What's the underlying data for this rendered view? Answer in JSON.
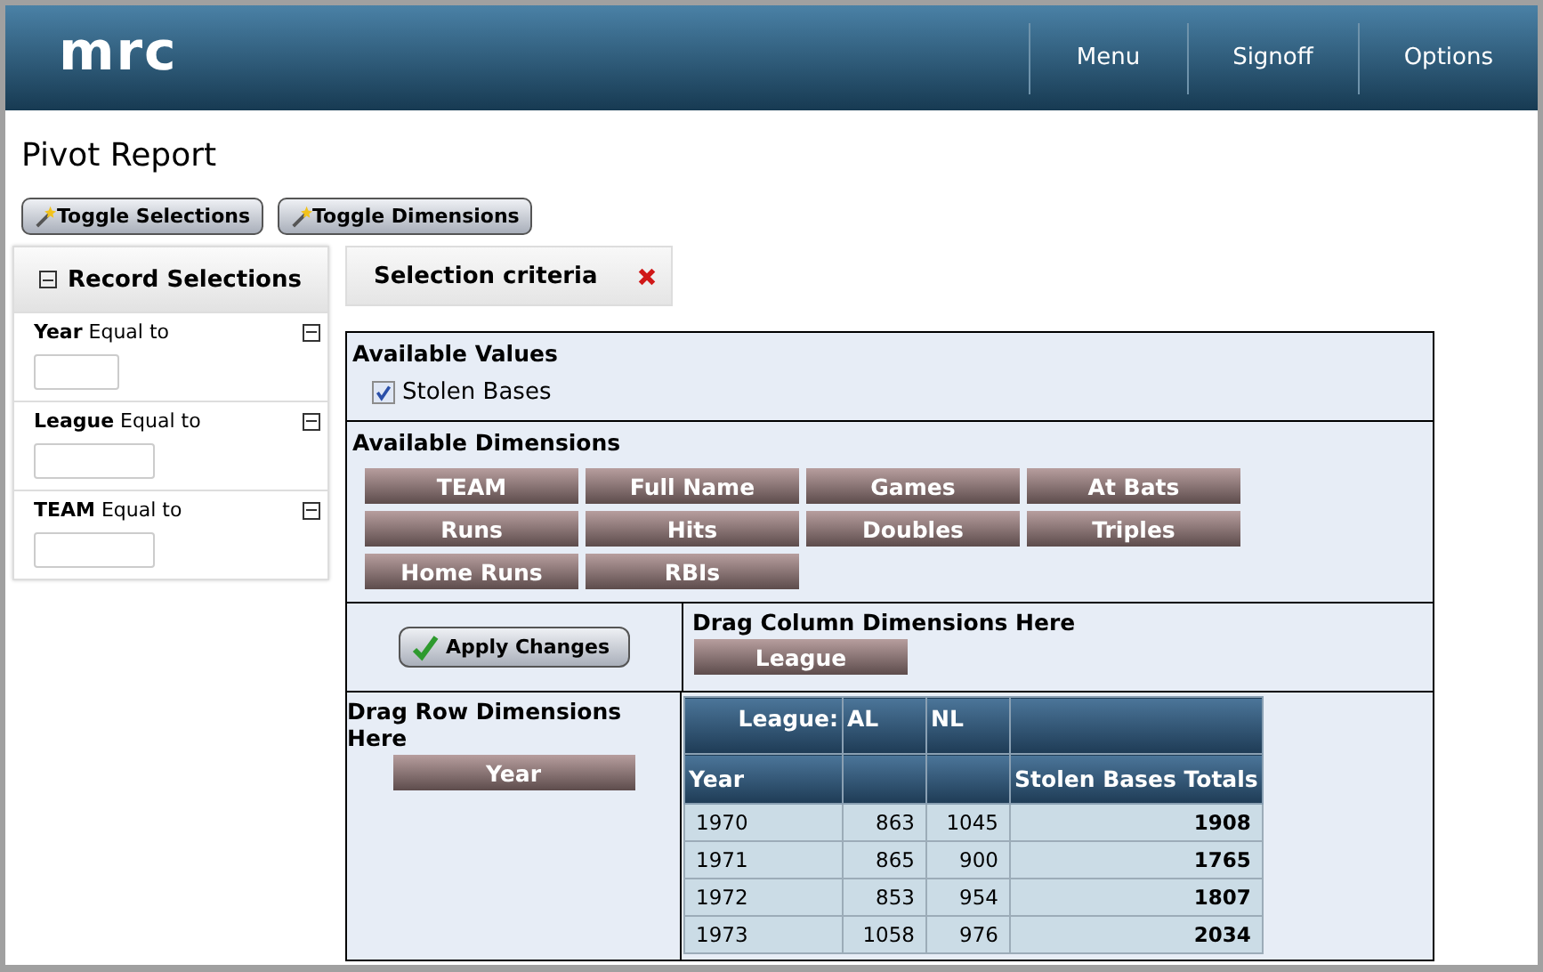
{
  "header": {
    "logo": "mrc",
    "nav": [
      "Menu",
      "Signoff",
      "Options"
    ]
  },
  "page_title": "Pivot Report",
  "toolbar": [
    "Toggle Selections",
    "Toggle Dimensions"
  ],
  "record_selections": {
    "title": "Record Selections",
    "filters": [
      {
        "field": "Year",
        "operator": "Equal to"
      },
      {
        "field": "League",
        "operator": "Equal to"
      },
      {
        "field": "TEAM",
        "operator": "Equal to"
      }
    ]
  },
  "selection_criteria": {
    "title": "Selection criteria"
  },
  "available_values": {
    "title": "Available Values",
    "items": [
      {
        "label": "Stolen Bases",
        "checked": true
      }
    ]
  },
  "available_dimensions": {
    "title": "Available Dimensions",
    "items": [
      "TEAM",
      "Full Name",
      "Games",
      "At Bats",
      "Runs",
      "Hits",
      "Doubles",
      "Triples",
      "Home Runs",
      "RBIs"
    ]
  },
  "apply_button": "Apply Changes",
  "column_zone": {
    "title": "Drag Column Dimensions Here",
    "items": [
      "League"
    ]
  },
  "row_zone": {
    "title": "Drag Row Dimensions Here",
    "items": [
      "Year"
    ]
  },
  "pivot": {
    "column_header_label": "League:",
    "column_values": [
      "AL",
      "NL"
    ],
    "row_header": "Year",
    "totals_header": "Stolen Bases Totals",
    "rows": [
      {
        "year": "1970",
        "values": [
          "863",
          "1045"
        ],
        "total": "1908"
      },
      {
        "year": "1971",
        "values": [
          "865",
          "900"
        ],
        "total": "1765"
      },
      {
        "year": "1972",
        "values": [
          "853",
          "954"
        ],
        "total": "1807"
      },
      {
        "year": "1973",
        "values": [
          "1058",
          "976"
        ],
        "total": "2034"
      }
    ]
  }
}
